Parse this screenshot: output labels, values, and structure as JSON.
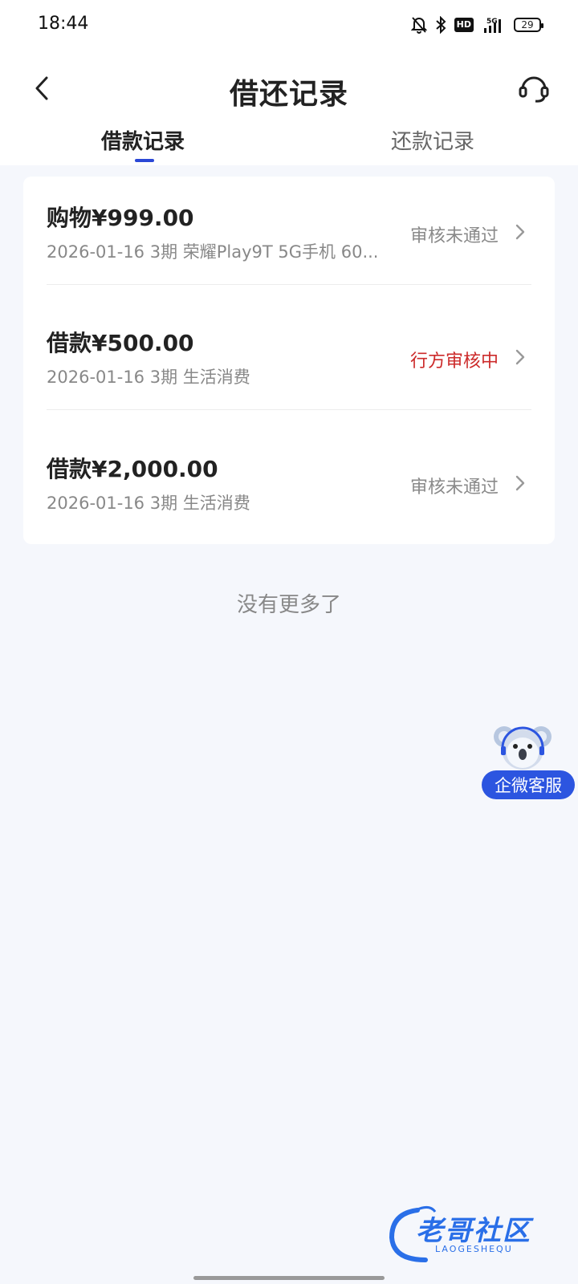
{
  "status_bar": {
    "time": "18:44",
    "hd": "HD",
    "network": "5G",
    "battery": "29"
  },
  "header": {
    "title": "借还记录"
  },
  "tabs": [
    {
      "label": "借款记录",
      "active": true
    },
    {
      "label": "还款记录",
      "active": false
    }
  ],
  "records": [
    {
      "title": "购物¥999.00",
      "subtitle": "2026-01-16 3期  荣耀Play9T 5G手机 60...",
      "status": "审核未通过",
      "status_color": "#8a8a8a"
    },
    {
      "title": "借款¥500.00",
      "subtitle": "2026-01-16 3期  生活消费",
      "status": "行方审核中",
      "status_color": "#cc2a2a"
    },
    {
      "title": "借款¥2,000.00",
      "subtitle": "2026-01-16 3期  生活消费",
      "status": "审核未通过",
      "status_color": "#8a8a8a"
    }
  ],
  "footer_text": "没有更多了",
  "floating_service": {
    "label": "企微客服"
  },
  "watermark": {
    "text": "老哥社区",
    "sub": "LAOGESHEQU"
  },
  "colors": {
    "accent": "#2b48d6",
    "status_red": "#cc2a2a",
    "page_bg": "#f5f7fc"
  }
}
